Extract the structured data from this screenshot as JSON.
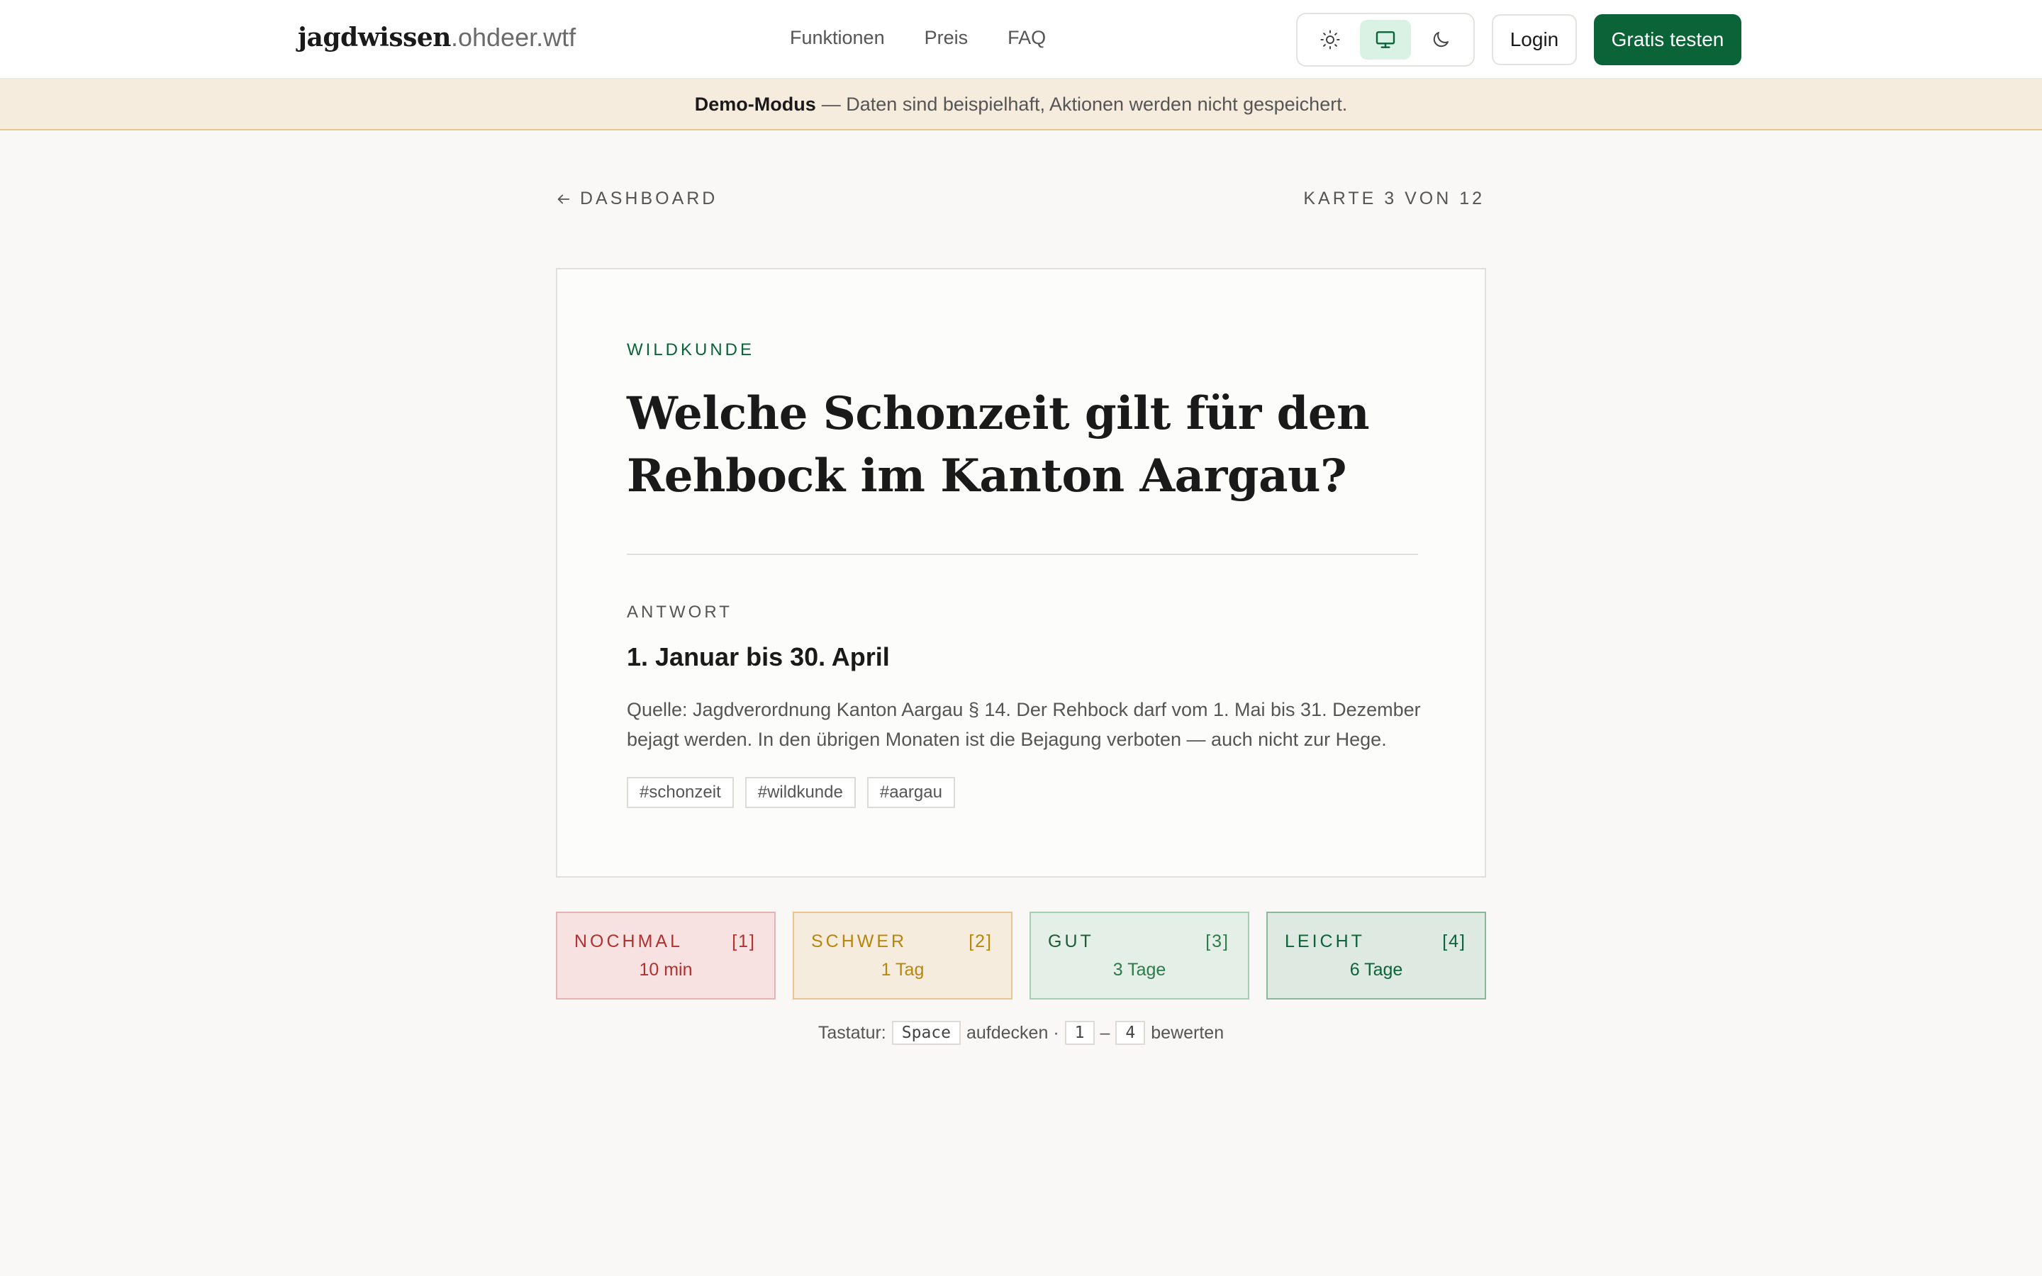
{
  "header": {
    "logo_main": "jagdwissen",
    "logo_sub": ".ohdeer.wtf",
    "nav": [
      "Funktionen",
      "Preis",
      "FAQ"
    ],
    "login_label": "Login",
    "trial_label": "Gratis testen",
    "theme_active": "system"
  },
  "banner": {
    "title": "Demo-Modus",
    "text": "— Daten sind beispielhaft, Aktionen werden nicht gespeichert."
  },
  "breadcrumb": {
    "back_label": "DASHBOARD",
    "counter": "KARTE 3 VON 12"
  },
  "card": {
    "category": "WILDKUNDE",
    "question_line1": "Welche Schonzeit gilt für den",
    "question_line2": "Rehbock im Kanton Aargau?",
    "answer_label": "ANTWORT",
    "answer": "1. Januar bis 30. April",
    "source": "Quelle: Jagdverordnung Kanton Aargau § 14. Der Rehbock darf vom 1. Mai bis 31. Dezember bejagt werden. In den übrigen Monaten ist die Bejagung verboten — auch nicht zur Hege.",
    "tags": [
      "#schonzeit",
      "#wildkunde",
      "#aargau"
    ]
  },
  "ratings": [
    {
      "label": "NOCHMAL",
      "key": "[1]",
      "time": "10 min"
    },
    {
      "label": "SCHWER",
      "key": "[2]",
      "time": "1 Tag"
    },
    {
      "label": "GUT",
      "key": "[3]",
      "time": "3 Tage"
    },
    {
      "label": "LEICHT",
      "key": "[4]",
      "time": "6 Tage"
    }
  ],
  "keyboard": {
    "prefix": "Tastatur:",
    "key_space": "Space",
    "reveal": "aufdecken ·",
    "key_1": "1",
    "dash": "–",
    "key_4": "4",
    "rate": "bewerten"
  },
  "colors": {
    "brand": "#0b6338",
    "banner_bg": "#f5ecde",
    "again": "#b2302e",
    "hard": "#b8860b",
    "good": "#2f7a4a",
    "easy": "#0b6338"
  }
}
